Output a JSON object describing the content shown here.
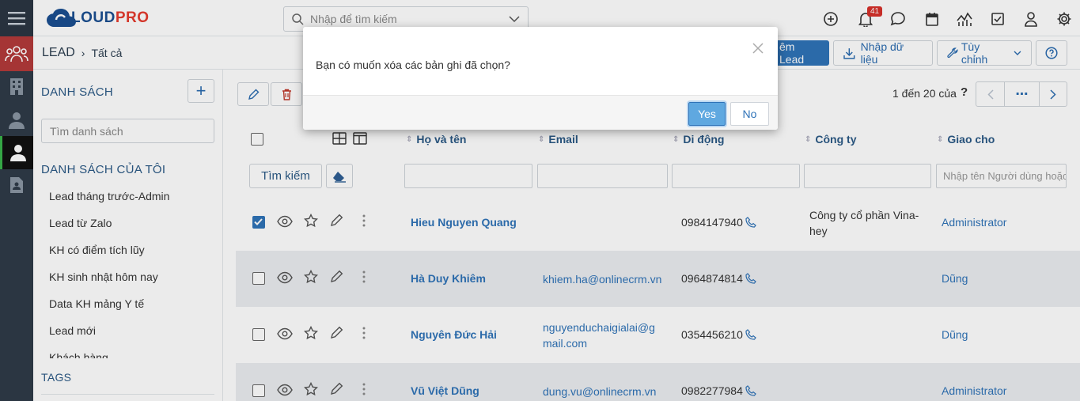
{
  "app": {
    "logo_prefix": "C",
    "logo_text_main": "LOUD",
    "logo_text_accent": "PRO"
  },
  "topbar": {
    "search_placeholder": "Nhập để tìm kiếm",
    "notification_count": "41",
    "icons": [
      "plus-circle-icon",
      "bell-icon",
      "chat-icon",
      "calendar-icon",
      "chart-icon",
      "checkbox-icon",
      "user-icon",
      "gear-icon"
    ]
  },
  "breadcrumb": {
    "module": "LEAD",
    "separator": "›",
    "current": "Tất cả"
  },
  "header_actions": {
    "add_lead": "êm Lead",
    "import": "Nhập dữ liệu",
    "customize": "Tùy chỉnh",
    "help": "?"
  },
  "sidebar": {
    "list_heading": "DANH SÁCH",
    "add_label": "+",
    "search_placeholder": "Tìm danh sách",
    "my_lists_heading": "DANH SÁCH CỦA TÔI",
    "items": [
      "Lead tháng trước-Admin",
      "Lead từ Zalo",
      "KH có điểm tích lũy",
      "KH sinh nhật hôm nay",
      "Data KH mảng Y tế",
      "Lead mới",
      "Khách hàng"
    ],
    "tags_heading": "TAGS"
  },
  "pager": {
    "text": "1 đến 20 của",
    "unknown": "?",
    "more": "⋯"
  },
  "table": {
    "columns": {
      "name": "Họ và tên",
      "email": "Email",
      "mobile": "Di động",
      "company": "Công ty",
      "assigned": "Giao cho"
    },
    "find_button": "Tìm kiếm",
    "assigned_filter_placeholder": "Nhập tên Người dùng hoặc",
    "rows": [
      {
        "name": "Hieu Nguyen Quang",
        "email": "",
        "mobile": "0984147940",
        "company": "Công ty cổ phần Vina-hey",
        "assigned": "Administrator",
        "checked": true
      },
      {
        "name": "Hà Duy Khiêm",
        "email": "khiem.ha@onlinecrm.vn",
        "mobile": "0964874814",
        "company": "",
        "assigned": "Dũng",
        "checked": false
      },
      {
        "name": "Nguyên Đức Hải",
        "email": "nguyenduchaigialai@gmail.com",
        "mobile": "0354456210",
        "company": "",
        "assigned": "Dũng",
        "checked": false
      },
      {
        "name": "Vũ Việt Dũng",
        "email": "dung.vu@onlinecrm.vn",
        "mobile": "0982277984",
        "company": "",
        "assigned": "Administrator",
        "checked": false
      }
    ]
  },
  "modal": {
    "message": "Bạn có muốn xóa các bản ghi đã chọn?",
    "yes": "Yes",
    "no": "No"
  },
  "colors": {
    "accent": "#2f73b8",
    "rail": "#2f3b48",
    "leads_active": "#b33a3a",
    "badge": "#d7312b"
  }
}
